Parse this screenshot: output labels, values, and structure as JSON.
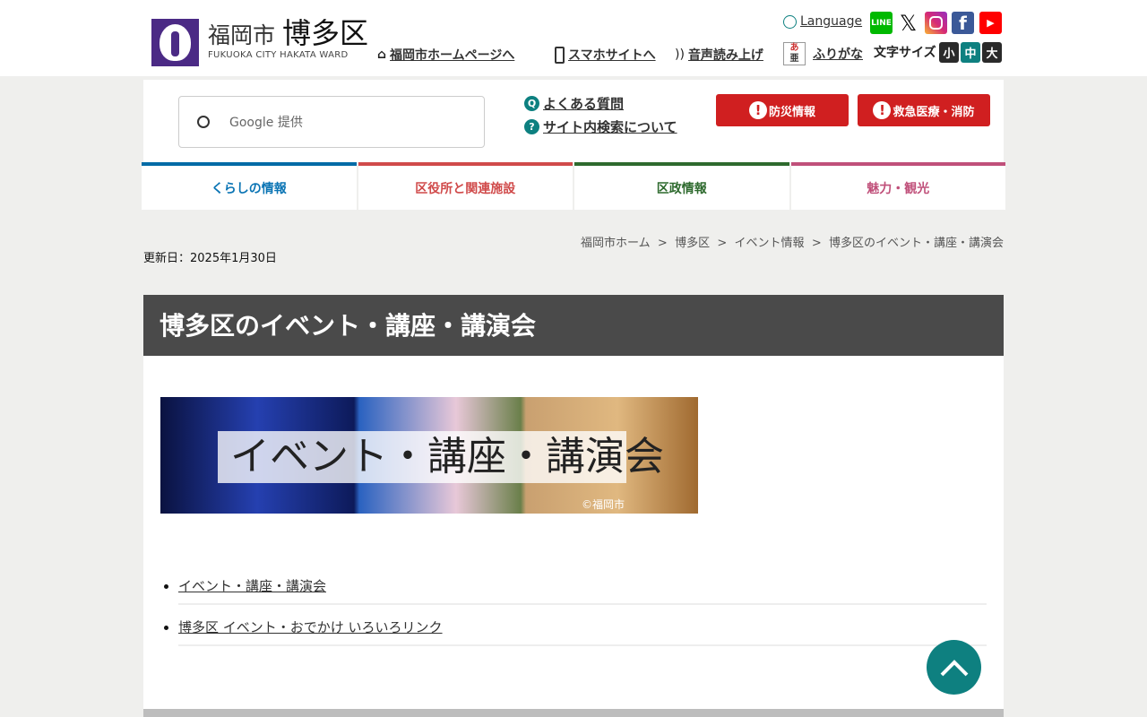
{
  "header": {
    "logo": {
      "city": "福岡市",
      "ward": "博多区",
      "english": "FUKUOKA CITY HAKATA WARD"
    },
    "links": [
      "福岡市ホームページへ",
      "スマホサイトへ",
      "音声読み上げ",
      "ふりがな"
    ],
    "language": "Language",
    "sns": [
      {
        "name": "LINE",
        "color": "#00b900"
      },
      {
        "name": "X",
        "color": "#000000"
      },
      {
        "name": "Instagram",
        "color": "#d62976"
      },
      {
        "name": "Facebook",
        "color": "#3b5998"
      },
      {
        "name": "YouTube",
        "color": "#ff0000"
      }
    ],
    "font_size": {
      "label": "文字サイズ",
      "options": [
        "小",
        "中",
        "大"
      ],
      "selected": "中"
    },
    "furigana_icon_text": "あ亜"
  },
  "search": {
    "placeholder": "Google 提供"
  },
  "help_links": [
    "よくある質問",
    "サイト内検索について"
  ],
  "emergency": [
    "防災情報",
    "救急医療・消防"
  ],
  "nav": [
    {
      "label": "くらしの情報",
      "color": "#006ba6"
    },
    {
      "label": "区役所と関連施設",
      "color": "#d04a4a"
    },
    {
      "label": "区政情報",
      "color": "#2e6a2e"
    },
    {
      "label": "魅力・観光",
      "color": "#c0507a"
    }
  ],
  "breadcrumb": {
    "items": [
      "福岡市ホーム",
      "博多区",
      "イベント情報",
      "博多区のイベント・講座・講演会"
    ],
    "sep": ">"
  },
  "updated": "更新日：2025年1月30日",
  "page": {
    "title": "博多区のイベント・講座・講演会",
    "banner": {
      "caption": "イベント・講座・講演会",
      "credit": "©福岡市"
    },
    "links": [
      "イベント・講座・講演会",
      "博多区 イベント・おでかけ いろいろリンク"
    ]
  }
}
